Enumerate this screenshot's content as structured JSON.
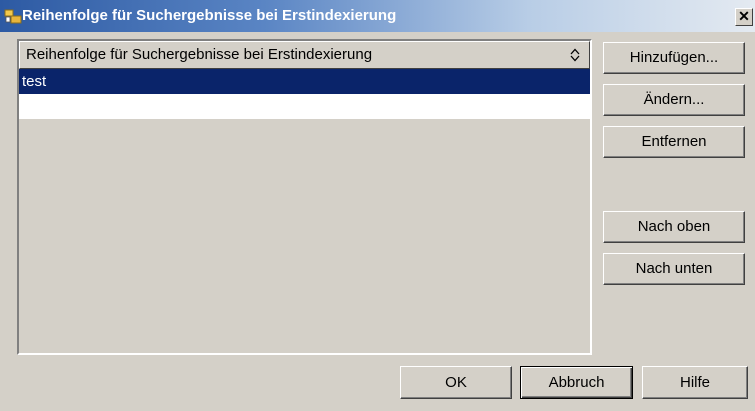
{
  "window": {
    "title": "Reihenfolge für Suchergebnisse bei Erstindexierung",
    "close_glyph": "✕",
    "app_icon": "folder-icon"
  },
  "list": {
    "column_header": "Reihenfolge für Suchergebnisse bei Erstindexierung",
    "sort_icon": "sort-icon",
    "items": [
      "test"
    ],
    "selected_color": "#0a246a"
  },
  "side_buttons": {
    "add": "Hinzufügen...",
    "change": "Ändern...",
    "remove": "Entfernen",
    "move_up": "Nach oben",
    "move_down": "Nach unten"
  },
  "footer_buttons": {
    "ok": "OK",
    "cancel": "Abbruch",
    "help": "Hilfe"
  }
}
